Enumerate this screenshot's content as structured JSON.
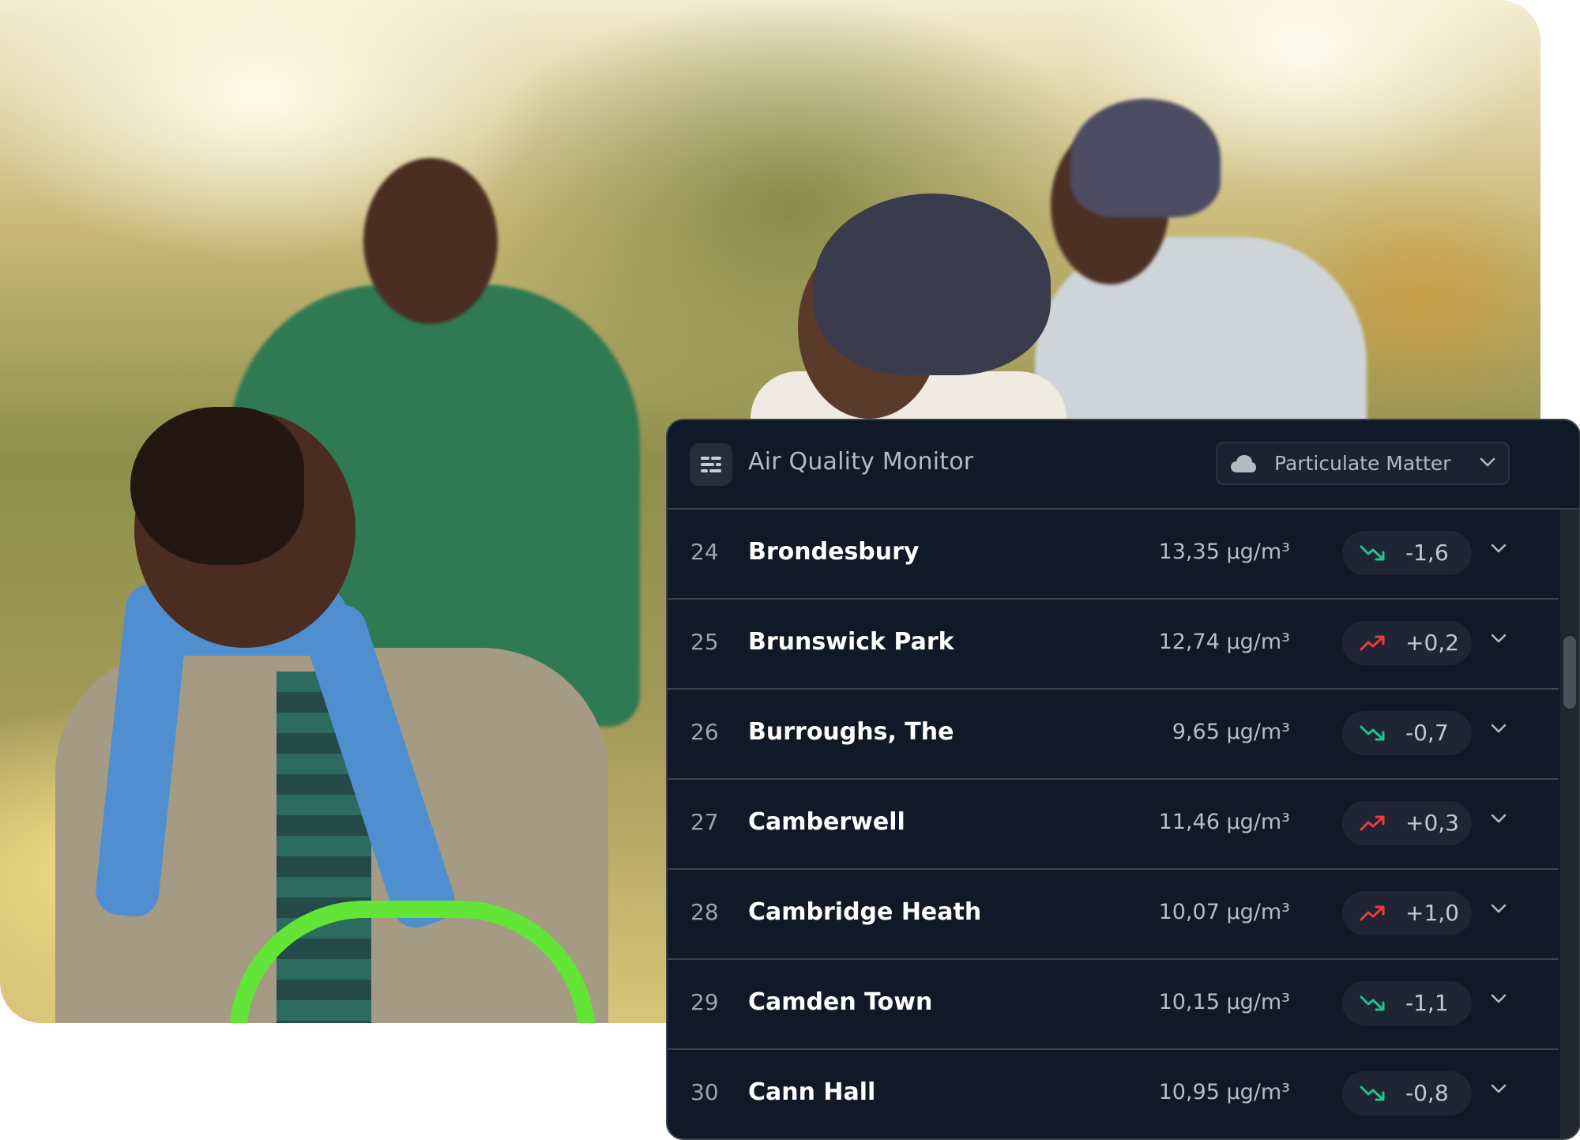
{
  "photo": {
    "description": "Family smiling outdoors on bicycles in sunny autumn park"
  },
  "panel": {
    "title": "Air Quality Monitor",
    "menu_icon": "list-filter-icon",
    "dropdown": {
      "icon": "cloud-icon",
      "selected": "Particulate Matter",
      "chevron_icon": "chevron-down-icon"
    },
    "colors": {
      "background": "#111827",
      "border": "#3b414d",
      "trend_down": "#22c38e",
      "trend_up": "#ef3b3b"
    },
    "rows": [
      {
        "rank": "24",
        "name": "Brondesbury",
        "value": "13,35 μg/m³",
        "trend": "down",
        "delta": "-1,6"
      },
      {
        "rank": "25",
        "name": "Brunswick Park",
        "value": "12,74 μg/m³",
        "trend": "up",
        "delta": "+0,2"
      },
      {
        "rank": "26",
        "name": "Burroughs, The",
        "value": "9,65 μg/m³",
        "trend": "down",
        "delta": "-0,7"
      },
      {
        "rank": "27",
        "name": "Camberwell",
        "value": "11,46 μg/m³",
        "trend": "up",
        "delta": "+0,3"
      },
      {
        "rank": "28",
        "name": "Cambridge Heath",
        "value": "10,07 μg/m³",
        "trend": "up",
        "delta": "+1,0"
      },
      {
        "rank": "29",
        "name": "Camden Town",
        "value": "10,15 μg/m³",
        "trend": "down",
        "delta": "-1,1"
      },
      {
        "rank": "30",
        "name": "Cann Hall",
        "value": "10,95 μg/m³",
        "trend": "down",
        "delta": "-0,8"
      }
    ]
  }
}
